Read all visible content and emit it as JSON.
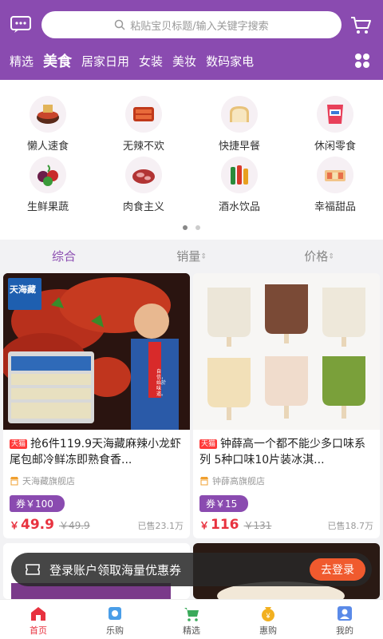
{
  "search": {
    "placeholder": "粘贴宝贝标题/输入关键字搜索"
  },
  "categories": [
    "精选",
    "美食",
    "居家日用",
    "女装",
    "美妆",
    "数码家电"
  ],
  "active_category": "美食",
  "sub_categories": [
    {
      "label": "懒人速食",
      "icon": "instant-food-icon"
    },
    {
      "label": "无辣不欢",
      "icon": "spicy-food-icon"
    },
    {
      "label": "快捷早餐",
      "icon": "bread-icon"
    },
    {
      "label": "休闲零食",
      "icon": "snack-bag-icon"
    },
    {
      "label": "生鲜果蔬",
      "icon": "fruit-icon"
    },
    {
      "label": "肉食主义",
      "icon": "meat-icon"
    },
    {
      "label": "酒水饮品",
      "icon": "drinks-icon"
    },
    {
      "label": "幸福甜品",
      "icon": "dessert-icon"
    }
  ],
  "sort": [
    "综合",
    "销量",
    "价格"
  ],
  "products": [
    {
      "badge": "天猫",
      "title": "抢6件119.9天海藏麻辣小龙虾尾包邮冷鲜冻即熟食香...",
      "shop": "天海藏旗舰店",
      "coupon": "券￥100",
      "price": "49.9",
      "original": "￥49.9",
      "sold": "已售23.1万",
      "brand_logo": "天海藏",
      "image_overlay": "自信，始於味道。"
    },
    {
      "badge": "天猫",
      "title": "钟薛高一个都不能少多口味系列 5种口味10片装冰淇...",
      "shop": "钟薛高旗舰店",
      "coupon": "券￥15",
      "price": "116",
      "original": "￥131",
      "sold": "已售18.7万"
    }
  ],
  "login_banner": {
    "text": "登录账户领取海量优惠券",
    "button": "去登录"
  },
  "bottom_nav": [
    "首页",
    "乐购",
    "精选",
    "惠购",
    "我的"
  ],
  "colors": {
    "primary": "#8a4bb0",
    "price": "#e8323f",
    "login_button": "#f05a2e"
  }
}
